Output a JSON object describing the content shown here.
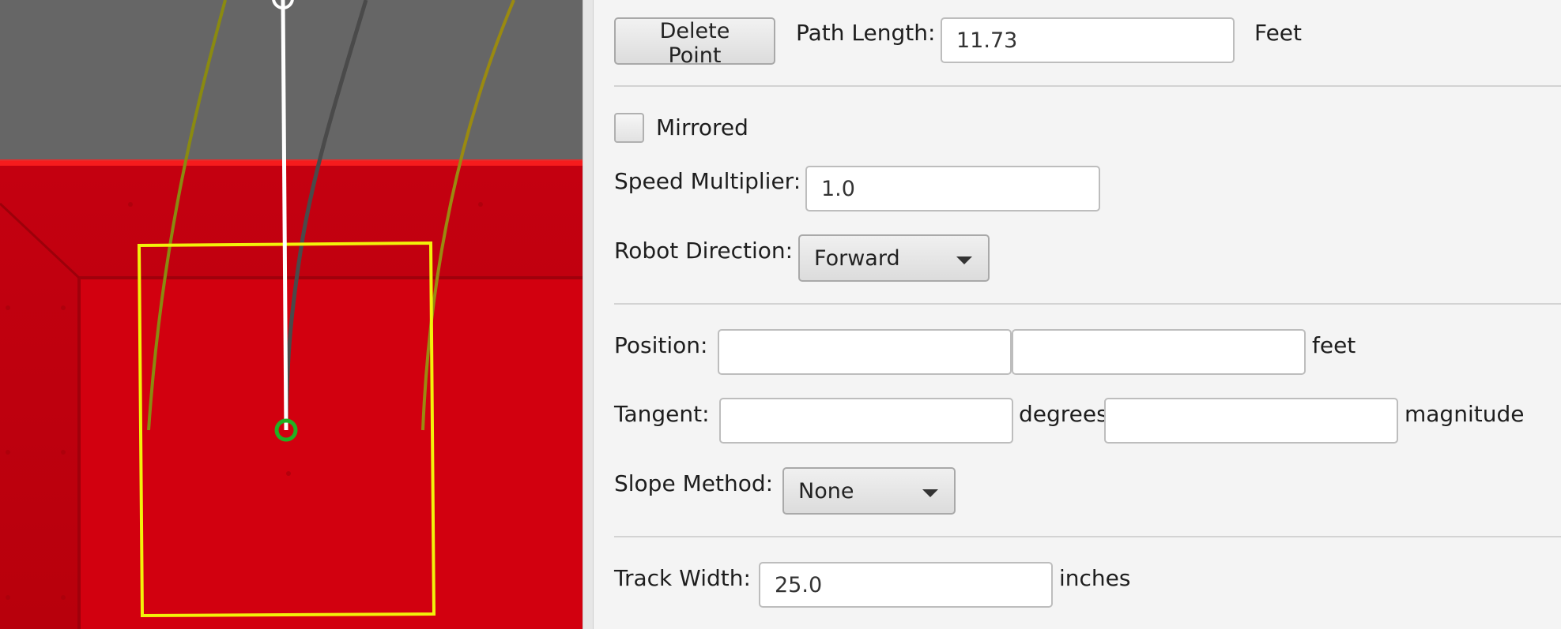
{
  "editor": {
    "delete_point_label": "Delete Point",
    "path_length_label": "Path Length:",
    "path_length_value": "11.73",
    "path_length_unit": "Feet",
    "mirrored_label": "Mirrored",
    "mirrored_checked": false,
    "speed_multiplier_label": "Speed Multiplier:",
    "speed_multiplier_value": "1.0",
    "robot_direction_label": "Robot Direction:",
    "robot_direction_value": "Forward",
    "position_label": "Position:",
    "position_x_value": "",
    "position_y_value": "",
    "position_unit": "feet",
    "tangent_label": "Tangent:",
    "tangent_angle_value": "",
    "tangent_angle_unit": "degrees",
    "tangent_magnitude_value": "",
    "tangent_magnitude_unit": "magnitude",
    "slope_method_label": "Slope Method:",
    "slope_method_value": "None",
    "track_width_label": "Track Width:",
    "track_width_value": "25.0",
    "track_width_unit": "inches"
  },
  "field": {
    "colors": {
      "background": "#666666",
      "alliance_red": "#c8000e",
      "path_center": "#ffffff",
      "path_shadow": "#4a4a4a",
      "wheel_track": "#8a8a10",
      "robot_outline": "#f2f20a",
      "selected_point": "#22b022"
    },
    "icons": {
      "waypoint": "circle-handle-icon",
      "selected_waypoint": "green-circle-icon"
    }
  }
}
